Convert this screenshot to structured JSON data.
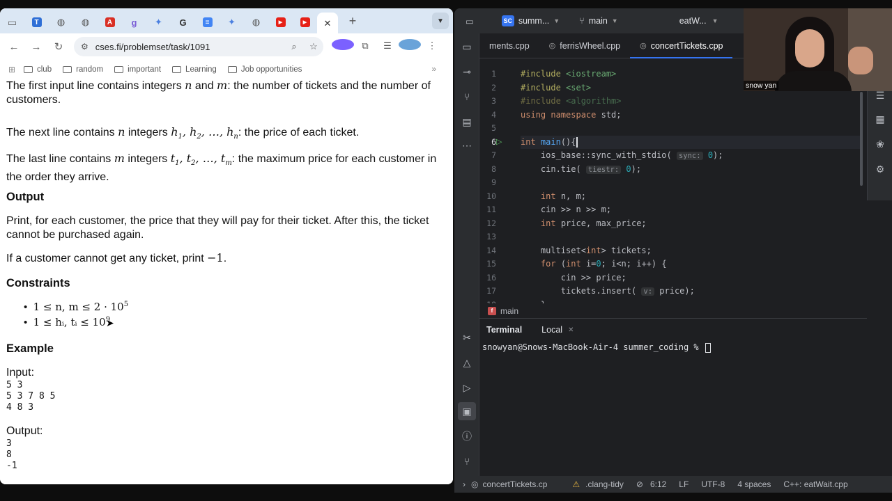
{
  "browser": {
    "tabs": [
      {
        "icon": "window-icon",
        "color": "#888888",
        "glyph": "▭"
      },
      {
        "icon": "t-icon",
        "color": "#2f6fd6",
        "glyph": "T"
      },
      {
        "icon": "globe-icon",
        "color": "#666666",
        "glyph": "◍"
      },
      {
        "icon": "globe-icon",
        "color": "#666666",
        "glyph": "◍"
      },
      {
        "icon": "pdf-icon",
        "color": "#d93025",
        "glyph": "A"
      },
      {
        "icon": "gist-icon",
        "color": "#7b5fd6",
        "glyph": "g"
      },
      {
        "icon": "gemini-icon",
        "color": "#4a7fe0",
        "glyph": "✦"
      },
      {
        "icon": "google-icon",
        "color": "#ffffff",
        "glyph": "G"
      },
      {
        "icon": "docs-icon",
        "color": "#4285f4",
        "glyph": "≡"
      },
      {
        "icon": "gemini-icon",
        "color": "#4a7fe0",
        "glyph": "✦"
      },
      {
        "icon": "globe-icon",
        "color": "#666666",
        "glyph": "◍"
      },
      {
        "icon": "youtube-icon",
        "color": "#e62117",
        "glyph": "▶"
      },
      {
        "icon": "youtube-icon",
        "color": "#e62117",
        "glyph": "▶"
      }
    ],
    "active_tab_close": "✕",
    "new_tab": "+",
    "url": "cses.fi/problemset/task/1091",
    "bookmarks": [
      "club",
      "random",
      "important",
      "Learning",
      "Job opportunities"
    ],
    "bookmarks_more": "»"
  },
  "problem": {
    "p1a": "The first input line contains integers ",
    "p1b": " and ",
    "p1c": ": the number of tickets and the number of customers.",
    "p2a": "The next line contains ",
    "p2b": " integers ",
    "p2c": ": the price of each ticket.",
    "p3a": "The last line contains ",
    "p3b": " integers ",
    "p3c": ": the maximum price for each customer in the order they arrive.",
    "output_heading": "Output",
    "output_text": "Print, for each customer, the price that they will pay for their ticket. After this, the ticket cannot be purchased again.",
    "neg_a": "If a customer cannot get any ticket, print ",
    "neg_b": "−1",
    "neg_c": ".",
    "constraints_heading": "Constraints",
    "constraint1": "1 ≤ n, m ≤ 2 · 10",
    "constraint1_exp": "5",
    "constraint2": "1 ≤ hᵢ, tᵢ ≤ 10",
    "constraint2_exp": "9",
    "example_heading": "Example",
    "input_label": "Input:",
    "input_lines": "5 3\n5 3 7 8 5\n4 8 3",
    "output_label": "Output:",
    "output_lines": "3\n8\n-1"
  },
  "ide": {
    "project_badge": "SC",
    "project_name": "summ...",
    "branch": "main",
    "run_config": "eatW...",
    "tabs": [
      "ments.cpp",
      "ferrisWheel.cpp",
      "concertTickets.cpp"
    ],
    "breadcrumb": "main",
    "terminal_tab": "Terminal",
    "terminal_local": "Local",
    "prompt": "snowyan@Snows-MacBook-Air-4 summer_coding % ",
    "status": {
      "file": "concertTickets.cp",
      "inspection": ".clang-tidy",
      "position": "6:12",
      "line_sep": "LF",
      "encoding": "UTF-8",
      "indent": "4 spaces",
      "context": "C++: eatWait.cpp"
    },
    "webcam_label": "snow yan"
  }
}
